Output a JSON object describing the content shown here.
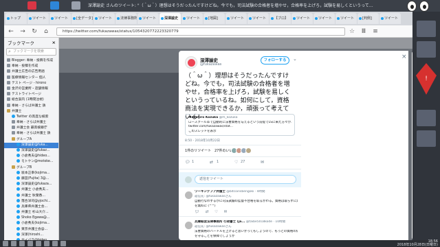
{
  "desktop": {
    "title": "深澤諭史 さんのツイート: \"（＾ω＾）理想はそうだったんですけどね。今でも，司法試験の合格者を増やせ，合格率を上げろ，試験を易しくというっているね。如何にして，資格商法を実現できるか，頑張って考えている！...\" - Mozilla Firefox",
    "tray_time": "18:56",
    "tray_date": "2018年10月28日(日曜日)"
  },
  "browser": {
    "tabs": [
      "トップ",
      "ツイート",
      "ツイート",
      "[全データ]",
      "ツイート",
      "法律事務所",
      "ツイート",
      "深澤諭史",
      "ツイート",
      "[地図]",
      "ツイート",
      "ツイート",
      "【ブロ】",
      "ツイート",
      "ツイート",
      "ツイート",
      "[判例]",
      "ツイート"
    ],
    "active_tab_index": 7,
    "url": "https://twitter.com/fukazawas/status/1054320772223320779"
  },
  "sidebar": {
    "title": "ブックマーク",
    "search_placeholder": "ブックマークを検索",
    "items": [
      {
        "label": "Blogger: 奉納 - 投稿を作成",
        "icon": "page",
        "indent": 0
      },
      {
        "label": "奉納 - 投稿を作成",
        "icon": "page",
        "indent": 0
      },
      {
        "label": "弁護士広告の広告用語",
        "icon": "page",
        "indent": 0
      },
      {
        "label": "医療情報センター 個人",
        "icon": "page",
        "indent": 0
      },
      {
        "label": "テスト ページ - hirono",
        "icon": "page",
        "indent": 0
      },
      {
        "label": "金沢の営業所・店舗情報",
        "icon": "page",
        "indent": 0
      },
      {
        "label": "テストライトページ",
        "icon": "page",
        "indent": 0
      },
      {
        "label": "総合案内 (1時間注視)",
        "icon": "page",
        "indent": 0
      },
      {
        "label": "奉納 - さらば弁護士 鉄",
        "icon": "page",
        "indent": 0
      },
      {
        "label": "弁護士",
        "icon": "folder",
        "indent": 0
      },
      {
        "label": "Twitter の高度な検索",
        "icon": "twitter",
        "indent": 1
      },
      {
        "label": "奉納 - さらば弁護士",
        "icon": "page",
        "indent": 1
      },
      {
        "label": "弁護士会 最高検察庁",
        "icon": "page",
        "indent": 1
      },
      {
        "label": "奉納 - さらば弁護士 鉄",
        "icon": "page",
        "indent": 1
      },
      {
        "label": "グループA",
        "icon": "folder",
        "indent": 1
      },
      {
        "label": "深澤諭史@fuka...",
        "icon": "twitter",
        "indent": 2,
        "selected": true
      },
      {
        "label": "深澤諭史@fukaz...",
        "icon": "twitter",
        "indent": 2
      },
      {
        "label": "小倉秀夫@hideo...",
        "icon": "twitter",
        "indent": 2
      },
      {
        "label": "モトケン@motoke...",
        "icon": "twitter",
        "indent": 2
      },
      {
        "label": "グループB",
        "icon": "folder",
        "indent": 1
      },
      {
        "label": "坂本正幸(kojima...",
        "icon": "twitter",
        "indent": 2
      },
      {
        "label": "藤田(Fujita) 3@...",
        "icon": "twitter",
        "indent": 2
      },
      {
        "label": "深澤諭史@fukaza...",
        "icon": "twitter",
        "indent": 2
      },
      {
        "label": "弁護士 小倉秀夫...",
        "icon": "twitter",
        "indent": 2
      },
      {
        "label": "弁護士 秋葉香...",
        "icon": "twitter",
        "indent": 2
      },
      {
        "label": "落合洋司@yjochi...",
        "icon": "twitter",
        "indent": 2
      },
      {
        "label": "兵庫県弁護士会...",
        "icon": "twitter",
        "indent": 2
      },
      {
        "label": "弁護士 杉山大介...",
        "icon": "twitter",
        "indent": 2
      },
      {
        "label": "Shoko Egawa@...",
        "icon": "twitter",
        "indent": 2
      },
      {
        "label": "小倉秀夫(kojima...",
        "icon": "twitter",
        "indent": 2
      },
      {
        "label": "東京弁護士会@...",
        "icon": "twitter",
        "indent": 2
      },
      {
        "label": "深澤(hiroshi...",
        "icon": "twitter",
        "indent": 2
      },
      {
        "label": "サイバラ@hideo...",
        "icon": "twitter",
        "indent": 2
      },
      {
        "label": "弁護士 吉田誠...",
        "icon": "twitter",
        "indent": 2
      }
    ]
  },
  "page_bg": {
    "name": "深澤諭史",
    "handle": "@fukazawas",
    "follow": "フォローする"
  },
  "tweet": {
    "author_name": "深澤諭史",
    "author_handle": "@fukazawas",
    "follow_label": "フォローする",
    "text": "（＾ω＾）理想はそうだったんですけどね。今でも，司法試験の合格者を増やせ，合格率を上げろ，試験を易しくというっているね。如何にして，資格商法を実現できるか，頑張って考えている！",
    "quote": {
      "author": "Masahiro Kozuka",
      "handle": "@m_kozuka",
      "line1": "ロースクール卒で自動的に法曹資格を与えるという前提でLSに来た方々が...",
      "line2": "twitter.com/fukazawas/stat...",
      "show_thread": "このスレッドを表示"
    },
    "timestamp": "8:50 - 2018年10月22日",
    "retweets": "1件のリツイート",
    "likes": "27件のいいね",
    "reply_count": "1",
    "retweet_count": "1",
    "like_count": "27",
    "reply_placeholder": "返信をツイート",
    "replies": [
      {
        "name": "ワーキングプア弁護士",
        "handle": "@bitcoinsbengoki",
        "time": "· 4時間",
        "reply_to": "返信先: @fukazawasさん",
        "line1": "自動行なわずるかに司法試験の監督不合格を取るかわる。資格は取らずに無理が自由",
        "line2": "を無料に (^^)",
        "replies": "",
        "likes": ""
      },
      {
        "name": "兵庫経営法律事務所 行政書士 (ja...",
        "handle": "@taibe5018kode",
        "time": "· 10時間",
        "reply_to": "返信先: @fukazawasさん",
        "line1": "法曹資格のハードルを上げると思いかってもしょうので、もっとの資格の価値",
        "line2": "を守ることを保障でしょうか",
        "replies": "",
        "likes": ""
      }
    ]
  }
}
